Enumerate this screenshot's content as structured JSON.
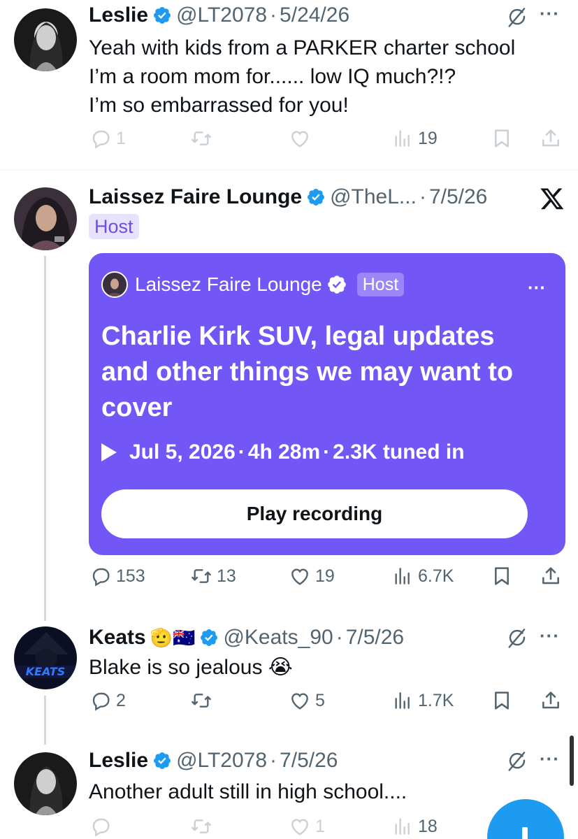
{
  "tweets": [
    {
      "name": "Leslie",
      "handle": "@LT2078",
      "date": "5/24/26",
      "text": "Yeah with kids from a PARKER charter school\nI’m a room mom for...... low IQ much?!?\nI’m so embarrassed for you!",
      "replies": "1",
      "retweets": "",
      "likes": "",
      "views": "19",
      "faded": true
    },
    {
      "name": "Laissez Faire Lounge",
      "handle": "@TheL...",
      "date": "7/5/26",
      "badge": "Host",
      "replies": "153",
      "retweets": "13",
      "likes": "19",
      "views": "6.7K"
    },
    {
      "name": "Keats",
      "emoji": "🫡🇦🇺",
      "handle": "@Keats_90",
      "date": "7/5/26",
      "text": "Blake is so jealous 😭",
      "replies": "2",
      "retweets": "",
      "likes": "5",
      "views": "1.7K"
    },
    {
      "name": "Leslie",
      "handle": "@LT2078",
      "date": "7/5/26",
      "text": "Another adult still in high school....",
      "replies": "",
      "retweets": "",
      "likes": "1",
      "views": "18",
      "faded": true
    }
  ],
  "space": {
    "host_name": "Laissez Faire Lounge",
    "host_badge": "Host",
    "title": "Charlie Kirk SUV, legal updates and other things we may want to cover",
    "date": "Jul 5, 2026",
    "duration": "4h 28m",
    "listeners": "2.3K tuned in",
    "button_label": "Play recording",
    "color": "#7356f6"
  },
  "separator": "·",
  "more_glyph": "···",
  "colors": {
    "accent": "#1d9bf0",
    "verified": "#1d9bf0",
    "muted": "#536471"
  },
  "icons": [
    "verified-badge-icon",
    "grok-icon",
    "more-icon",
    "x-logo-icon",
    "reply-icon",
    "retweet-icon",
    "like-icon",
    "views-icon",
    "bookmark-icon",
    "share-icon",
    "play-icon",
    "compose-icon"
  ]
}
